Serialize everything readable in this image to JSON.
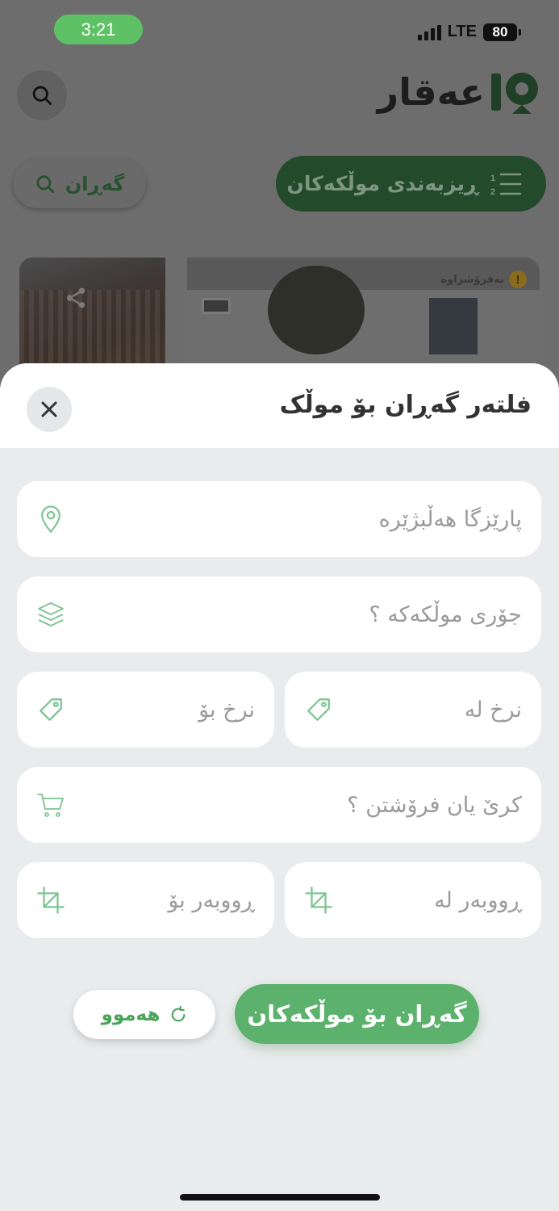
{
  "status_bar": {
    "time": "3:21",
    "network": "LTE",
    "battery": "80"
  },
  "header": {
    "logo_text": "عەقار"
  },
  "background": {
    "sort_label": "ڕیزبەندی موڵکەکان",
    "find_label": "گەڕان",
    "listing_badge": "نەفرۆشراوە"
  },
  "sheet": {
    "title": "فلتەر گەڕان بۆ موڵک",
    "fields": {
      "location": "پارێزگا هەڵبژێرە",
      "property_type": "جۆری موڵکەکە ؟",
      "price_from": "نرخ لە",
      "price_to": "نرخ بۆ",
      "rent_or_sale": "کرێ یان فرۆشتن ؟",
      "area_from": "ڕووبەر لە",
      "area_to": "ڕووبەر بۆ"
    },
    "search_button": "گەڕان بۆ موڵکەکان",
    "all_button": "هەموو"
  },
  "colors": {
    "accent": "#5cb26c",
    "icon": "#7cc492",
    "sheet_bg": "#e9eced"
  }
}
